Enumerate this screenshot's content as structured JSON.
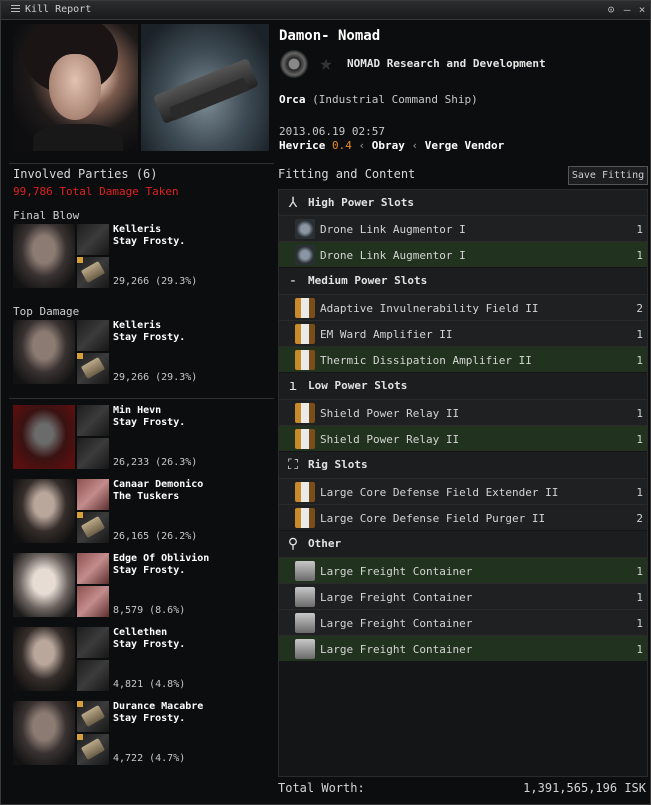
{
  "window": {
    "title": "Kill Report"
  },
  "victim": {
    "name": "Damon- Nomad",
    "corporation": "NOMAD Research and Development",
    "ship": "Orca",
    "ship_class": "(Industrial Command Ship)",
    "timestamp": "2013.06.19 02:57",
    "system": "Hevrice",
    "security": "0.4",
    "constellation": "Obray",
    "region": "Verge Vendor"
  },
  "involved": {
    "title": "Involved Parties (6)",
    "total_damage": "99,786 Total Damage Taken",
    "final_blow_label": "Final Blow",
    "top_damage_label": "Top Damage",
    "final_blow": {
      "name": "Kelleris",
      "corp": "Stay Frosty.",
      "damage": "29,266 (29.3%)"
    },
    "top_damage": {
      "name": "Kelleris",
      "corp": "Stay Frosty.",
      "damage": "29,266 (29.3%)"
    },
    "others": [
      {
        "name": "Min Hevn",
        "corp": "Stay Frosty.",
        "damage": "26,233 (26.3%)"
      },
      {
        "name": "Canaar Demonico",
        "corp": "The Tuskers",
        "damage": "26,165 (26.2%)"
      },
      {
        "name": "Edge Of Oblivion",
        "corp": "Stay Frosty.",
        "damage": "8,579 (8.6%)"
      },
      {
        "name": "Cellethen",
        "corp": "Stay Frosty.",
        "damage": "4,821 (4.8%)"
      },
      {
        "name": "Durance Macabre",
        "corp": "Stay Frosty.",
        "damage": "4,722 (4.7%)"
      }
    ]
  },
  "fitting": {
    "title": "Fitting and Content",
    "save_label": "Save Fitting",
    "sections": [
      {
        "label": "High Power Slots",
        "icon": "high-slot-icon",
        "items": [
          {
            "name": "Drone Link Augmentor I",
            "qty": "1",
            "state": "destroyed"
          },
          {
            "name": "Drone Link Augmentor I",
            "qty": "1",
            "state": "dropped"
          }
        ]
      },
      {
        "label": "Medium Power Slots",
        "icon": "mid-slot-icon",
        "items": [
          {
            "name": "Adaptive Invulnerability Field II",
            "qty": "2",
            "state": "destroyed"
          },
          {
            "name": "EM Ward Amplifier II",
            "qty": "1",
            "state": "destroyed"
          },
          {
            "name": "Thermic Dissipation Amplifier II",
            "qty": "1",
            "state": "dropped"
          }
        ]
      },
      {
        "label": "Low Power Slots",
        "icon": "low-slot-icon",
        "items": [
          {
            "name": "Shield Power Relay II",
            "qty": "1",
            "state": "destroyed"
          },
          {
            "name": "Shield Power Relay II",
            "qty": "1",
            "state": "dropped"
          }
        ]
      },
      {
        "label": "Rig Slots",
        "icon": "rig-slot-icon",
        "items": [
          {
            "name": "Large Core Defense Field Extender II",
            "qty": "1",
            "state": "destroyed"
          },
          {
            "name": "Large Core Defense Field Purger II",
            "qty": "2",
            "state": "destroyed"
          }
        ]
      },
      {
        "label": "Other",
        "icon": "other-cargo-icon",
        "items": [
          {
            "name": "Large Freight Container",
            "qty": "1",
            "state": "dropped"
          },
          {
            "name": "Large Freight Container",
            "qty": "1",
            "state": "destroyed"
          },
          {
            "name": "Large Freight Container",
            "qty": "1",
            "state": "destroyed"
          },
          {
            "name": "Large Freight Container",
            "qty": "1",
            "state": "dropped"
          }
        ]
      }
    ]
  },
  "total": {
    "label": "Total Worth:",
    "value": "1,391,565,196 ISK"
  }
}
